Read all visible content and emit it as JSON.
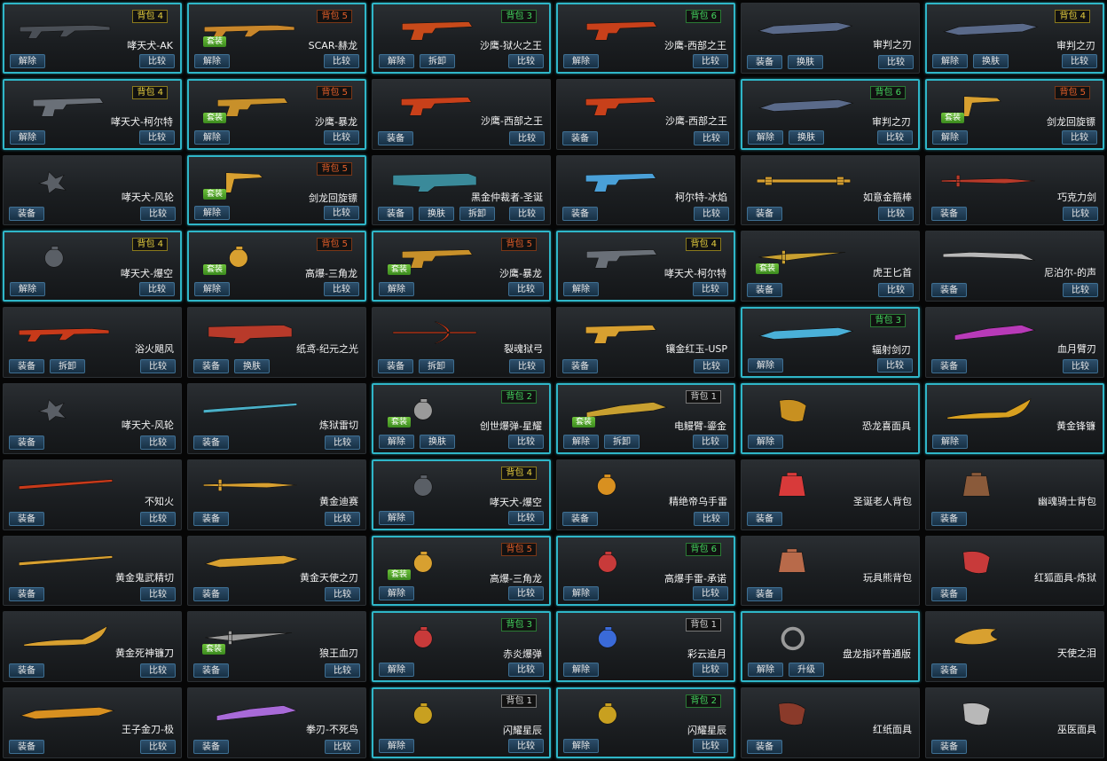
{
  "labels": {
    "unequip": "解除",
    "equip": "装备",
    "compare": "比较",
    "dismantle": "拆卸",
    "reskin": "换肤",
    "upgrade": "升级"
  },
  "colors": {
    "equipped_border": "#2fb6c8",
    "bag_yellow": "#e8d040",
    "bag_red": "#e8602a",
    "bag_green": "#45d860",
    "bag_white": "#d8d8d8",
    "set_tag": "#5aa82c"
  },
  "items": [
    {
      "name": "哮天犬-AK",
      "equipped": true,
      "bag": "背包 4",
      "bag_color": "y",
      "buttons": [
        "unequip",
        "compare"
      ],
      "icon": "rifle-icon",
      "tint": "#4a4f56"
    },
    {
      "name": "SCAR-赫龙",
      "equipped": true,
      "bag": "背包 5",
      "bag_color": "r",
      "set": "套装",
      "buttons": [
        "unequip",
        "compare"
      ],
      "icon": "rifle-icon",
      "tint": "#c8862a"
    },
    {
      "name": "沙鹰-狱火之王",
      "equipped": true,
      "bag": "背包 3",
      "bag_color": "g",
      "buttons": [
        "unequip",
        "dismantle",
        "compare"
      ],
      "icon": "pistol-icon",
      "tint": "#c84a1a"
    },
    {
      "name": "沙鹰-西部之王",
      "equipped": true,
      "bag": "背包 6",
      "bag_color": "g",
      "buttons": [
        "unequip",
        "compare"
      ],
      "icon": "pistol-icon",
      "tint": "#c8401a"
    },
    {
      "name": "审判之刃",
      "equipped": false,
      "buttons": [
        "equip",
        "reskin",
        "compare"
      ],
      "icon": "blade-icon",
      "tint": "#5a6a8a"
    },
    {
      "name": "审判之刃",
      "equipped": true,
      "bag": "背包 4",
      "bag_color": "y",
      "buttons": [
        "unequip",
        "reskin",
        "compare"
      ],
      "icon": "blade-icon",
      "tint": "#5a6a8a"
    },
    {
      "name": "哮天犬-柯尔特",
      "equipped": true,
      "bag": "背包 4",
      "bag_color": "y",
      "buttons": [
        "unequip",
        "compare"
      ],
      "icon": "pistol-icon",
      "tint": "#6a7078"
    },
    {
      "name": "沙鹰-暴龙",
      "equipped": true,
      "bag": "背包 5",
      "bag_color": "r",
      "set": "套装",
      "buttons": [
        "unequip",
        "compare"
      ],
      "icon": "pistol-icon",
      "tint": "#c8902a"
    },
    {
      "name": "沙鹰-西部之王",
      "equipped": false,
      "buttons": [
        "equip",
        "compare"
      ],
      "icon": "pistol-icon",
      "tint": "#c8401a"
    },
    {
      "name": "沙鹰-西部之王",
      "equipped": false,
      "buttons": [
        "equip",
        "compare"
      ],
      "icon": "pistol-icon",
      "tint": "#c8401a"
    },
    {
      "name": "审判之刃",
      "equipped": true,
      "bag": "背包 6",
      "bag_color": "g",
      "buttons": [
        "unequip",
        "reskin",
        "compare"
      ],
      "icon": "blade-icon",
      "tint": "#5a6a8a"
    },
    {
      "name": "剑龙回旋镖",
      "equipped": true,
      "bag": "背包 5",
      "bag_color": "r",
      "set": "套装",
      "buttons": [
        "unequip",
        "compare"
      ],
      "icon": "boomerang-icon",
      "tint": "#d8a030"
    },
    {
      "name": "哮天犬-风轮",
      "equipped": false,
      "buttons": [
        "equip",
        "compare"
      ],
      "icon": "shuriken-icon",
      "tint": "#5a5f66"
    },
    {
      "name": "剑龙回旋镖",
      "equipped": true,
      "bag": "背包 5",
      "bag_color": "r",
      "set": "套装",
      "buttons": [
        "unequip",
        "compare"
      ],
      "icon": "boomerang-icon",
      "tint": "#d8a030"
    },
    {
      "name": "黑金仲裁者-圣诞",
      "equipped": false,
      "buttons": [
        "equip",
        "reskin",
        "dismantle",
        "compare"
      ],
      "icon": "launcher-icon",
      "tint": "#3a8a9a"
    },
    {
      "name": "柯尔特-冰焰",
      "equipped": false,
      "buttons": [
        "equip",
        "compare"
      ],
      "icon": "pistol-icon",
      "tint": "#4aa0d8"
    },
    {
      "name": "如意金箍棒",
      "equipped": false,
      "buttons": [
        "equip",
        "compare"
      ],
      "icon": "staff-icon",
      "tint": "#d8a030"
    },
    {
      "name": "巧克力剑",
      "equipped": false,
      "buttons": [
        "equip",
        "compare"
      ],
      "icon": "sword-icon",
      "tint": "#b83a2a"
    },
    {
      "name": "哮天犬-爆空",
      "equipped": true,
      "bag": "背包 4",
      "bag_color": "y",
      "buttons": [
        "unequip",
        "compare"
      ],
      "icon": "grenade-icon",
      "tint": "#5a5f66"
    },
    {
      "name": "高爆-三角龙",
      "equipped": true,
      "bag": "背包 5",
      "bag_color": "r",
      "set": "套装",
      "buttons": [
        "unequip",
        "compare"
      ],
      "icon": "grenade-icon",
      "tint": "#d8a030"
    },
    {
      "name": "沙鹰-暴龙",
      "equipped": true,
      "bag": "背包 5",
      "bag_color": "r",
      "set": "套装",
      "buttons": [
        "unequip",
        "compare"
      ],
      "icon": "pistol-icon",
      "tint": "#c8902a"
    },
    {
      "name": "哮天犬-柯尔特",
      "equipped": true,
      "bag": "背包 4",
      "bag_color": "y",
      "buttons": [
        "unequip",
        "compare"
      ],
      "icon": "pistol-icon",
      "tint": "#6a7078"
    },
    {
      "name": "虎王匕首",
      "equipped": false,
      "set": "套装",
      "buttons": [
        "equip",
        "compare"
      ],
      "icon": "dagger-icon",
      "tint": "#c8a030"
    },
    {
      "name": "尼泊尔-的声",
      "equipped": false,
      "buttons": [
        "equip",
        "compare"
      ],
      "icon": "machete-icon",
      "tint": "#b8b8b8"
    },
    {
      "name": "浴火飓风",
      "equipped": false,
      "buttons": [
        "equip",
        "dismantle",
        "compare"
      ],
      "icon": "rifle-icon",
      "tint": "#c83a1a"
    },
    {
      "name": "纸鸢-纪元之光",
      "equipped": false,
      "buttons": [
        "equip",
        "reskin"
      ],
      "icon": "launcher-icon",
      "tint": "#b83a2a"
    },
    {
      "name": "裂魂狱弓",
      "equipped": false,
      "buttons": [
        "equip",
        "dismantle",
        "compare"
      ],
      "icon": "bow-icon",
      "tint": "#c83a1a"
    },
    {
      "name": "镶金红玉-USP",
      "equipped": false,
      "buttons": [
        "equip",
        "compare"
      ],
      "icon": "pistol-icon",
      "tint": "#d8a030"
    },
    {
      "name": "辐射剑刃",
      "equipped": true,
      "bag": "背包 3",
      "bag_color": "g",
      "buttons": [
        "unequip",
        "compare"
      ],
      "icon": "blade-icon",
      "tint": "#4ab0d8"
    },
    {
      "name": "血月臂刃",
      "equipped": false,
      "buttons": [
        "equip",
        "compare"
      ],
      "icon": "claw-icon",
      "tint": "#b83ab8"
    },
    {
      "name": "哮天犬-风轮",
      "equipped": false,
      "buttons": [
        "equip",
        "compare"
      ],
      "icon": "shuriken-icon",
      "tint": "#5a5f66"
    },
    {
      "name": "炼狱雷切",
      "equipped": false,
      "buttons": [
        "equip",
        "compare"
      ],
      "icon": "katana-icon",
      "tint": "#4ab0c8"
    },
    {
      "name": "创世爆弹-星耀",
      "equipped": true,
      "bag": "背包 2",
      "bag_color": "g",
      "set": "套装",
      "buttons": [
        "unequip",
        "reskin",
        "compare"
      ],
      "icon": "grenade-icon",
      "tint": "#9a9a9a"
    },
    {
      "name": "电鳗臂-鎏金",
      "equipped": true,
      "bag": "背包 1",
      "bag_color": "w",
      "set": "套装",
      "buttons": [
        "unequip",
        "dismantle",
        "compare"
      ],
      "icon": "claw-icon",
      "tint": "#c8a030"
    },
    {
      "name": "恐龙喜面具",
      "equipped": true,
      "buttons": [
        "unequip"
      ],
      "icon": "mask-icon",
      "tint": "#c89020"
    },
    {
      "name": "黄金锋镰",
      "equipped": true,
      "buttons": [
        "unequip"
      ],
      "icon": "scythe-icon",
      "tint": "#d8a020"
    },
    {
      "name": "不知火",
      "equipped": false,
      "buttons": [
        "equip",
        "compare"
      ],
      "icon": "katana-icon",
      "tint": "#c83a1a"
    },
    {
      "name": "黄金迪赛",
      "equipped": false,
      "buttons": [
        "equip",
        "compare"
      ],
      "icon": "sword-icon",
      "tint": "#d8a030"
    },
    {
      "name": "哮天犬-爆空",
      "equipped": true,
      "bag": "背包 4",
      "bag_color": "y",
      "buttons": [
        "unequip",
        "compare"
      ],
      "icon": "grenade-icon",
      "tint": "#5a5f66"
    },
    {
      "name": "精绝帝乌手雷",
      "equipped": false,
      "buttons": [
        "equip",
        "compare"
      ],
      "icon": "grenade-icon",
      "tint": "#d89020"
    },
    {
      "name": "圣诞老人背包",
      "equipped": false,
      "buttons": [
        "equip"
      ],
      "icon": "backpack-icon",
      "tint": "#d83a3a"
    },
    {
      "name": "幽魂骑士背包",
      "equipped": false,
      "buttons": [
        "equip"
      ],
      "icon": "backpack-icon",
      "tint": "#8a5a3a"
    },
    {
      "name": "黄金鬼武精切",
      "equipped": false,
      "buttons": [
        "equip",
        "compare"
      ],
      "icon": "katana-icon",
      "tint": "#d8a030"
    },
    {
      "name": "黄金天使之刃",
      "equipped": false,
      "buttons": [
        "equip",
        "compare"
      ],
      "icon": "blade-icon",
      "tint": "#d8a030"
    },
    {
      "name": "高爆-三角龙",
      "equipped": true,
      "bag": "背包 5",
      "bag_color": "r",
      "set": "套装",
      "buttons": [
        "unequip",
        "compare"
      ],
      "icon": "grenade-icon",
      "tint": "#d8a030"
    },
    {
      "name": "高爆手雷-承诺",
      "equipped": true,
      "bag": "背包 6",
      "bag_color": "g",
      "buttons": [
        "unequip",
        "compare"
      ],
      "icon": "grenade-icon",
      "tint": "#c83a3a"
    },
    {
      "name": "玩具熊背包",
      "equipped": false,
      "buttons": [
        "equip"
      ],
      "icon": "backpack-icon",
      "tint": "#b86a4a"
    },
    {
      "name": "红狐面具-炼狱",
      "equipped": false,
      "buttons": [
        "equip"
      ],
      "icon": "mask-icon",
      "tint": "#c83a3a"
    },
    {
      "name": "黄金死神镰刀",
      "equipped": false,
      "buttons": [
        "equip",
        "compare"
      ],
      "icon": "scythe-icon",
      "tint": "#d8a030"
    },
    {
      "name": "狼王血刃",
      "equipped": false,
      "set": "套装",
      "buttons": [
        "equip",
        "compare"
      ],
      "icon": "dagger-icon",
      "tint": "#9a9a9a"
    },
    {
      "name": "赤炎爆弹",
      "equipped": true,
      "bag": "背包 3",
      "bag_color": "g",
      "buttons": [
        "unequip",
        "compare"
      ],
      "icon": "grenade-icon",
      "tint": "#c83a3a"
    },
    {
      "name": "彩云追月",
      "equipped": true,
      "bag": "背包 1",
      "bag_color": "w",
      "buttons": [
        "unequip",
        "compare"
      ],
      "icon": "grenade-icon",
      "tint": "#3a6ad8"
    },
    {
      "name": "盘龙指环普通版",
      "equipped": true,
      "buttons": [
        "unequip",
        "upgrade"
      ],
      "icon": "ring-icon",
      "tint": "#9a9a9a"
    },
    {
      "name": "天使之泪",
      "equipped": false,
      "buttons": [
        "equip"
      ],
      "icon": "wing-icon",
      "tint": "#d8a030"
    },
    {
      "name": "王子金刀-极",
      "equipped": false,
      "buttons": [
        "equip",
        "compare"
      ],
      "icon": "blade-icon",
      "tint": "#d89020"
    },
    {
      "name": "拳刃-不死鸟",
      "equipped": false,
      "buttons": [
        "equip",
        "compare"
      ],
      "icon": "claw-icon",
      "tint": "#a86ad8"
    },
    {
      "name": "闪耀星辰",
      "equipped": true,
      "bag": "背包 1",
      "bag_color": "w",
      "buttons": [
        "unequip",
        "compare"
      ],
      "icon": "grenade-icon",
      "tint": "#c8a020"
    },
    {
      "name": "闪耀星辰",
      "equipped": true,
      "bag": "背包 2",
      "bag_color": "g",
      "buttons": [
        "unequip",
        "compare"
      ],
      "icon": "grenade-icon",
      "tint": "#c8a020"
    },
    {
      "name": "红纸面具",
      "equipped": false,
      "buttons": [
        "equip"
      ],
      "icon": "mask-icon",
      "tint": "#8a3a2a"
    },
    {
      "name": "巫医面具",
      "equipped": false,
      "buttons": [
        "equip"
      ],
      "icon": "mask-icon",
      "tint": "#b8b8b8"
    }
  ]
}
